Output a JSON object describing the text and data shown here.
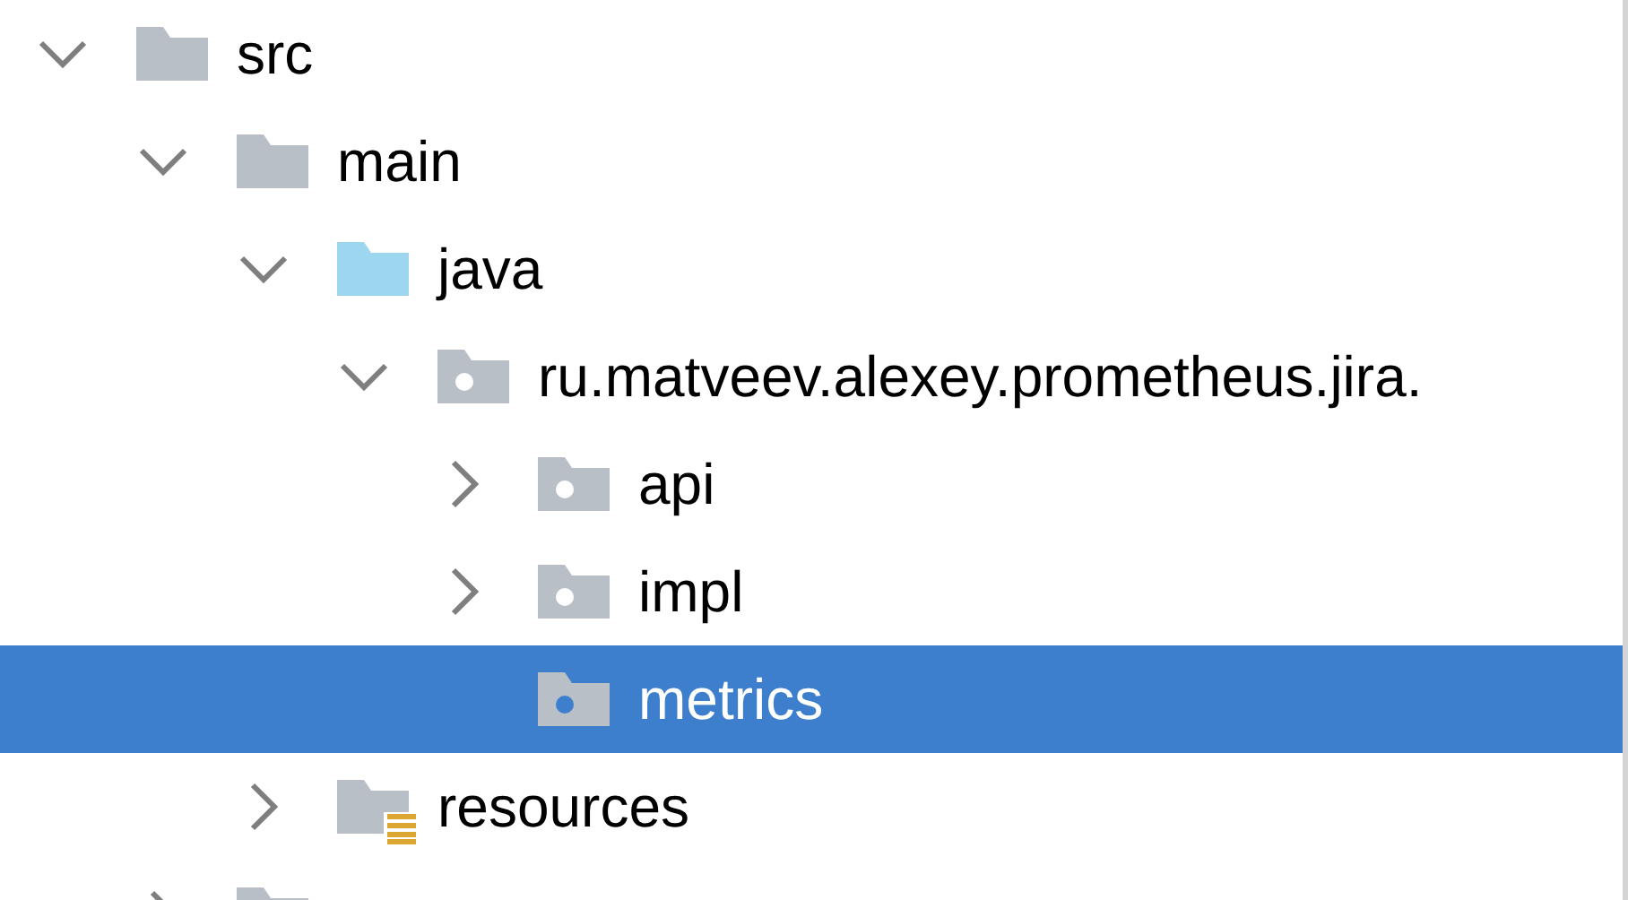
{
  "tree": [
    {
      "label": "src",
      "kind": "folder",
      "expanded": true,
      "selected": false,
      "children": [
        {
          "label": "main",
          "kind": "folder",
          "expanded": true,
          "selected": false,
          "children": [
            {
              "label": "java",
              "kind": "source-root",
              "expanded": true,
              "selected": false,
              "children": [
                {
                  "label": "ru.matveev.alexey.prometheus.jira.",
                  "kind": "package",
                  "expanded": true,
                  "selected": false,
                  "children": [
                    {
                      "label": "api",
                      "kind": "package",
                      "expanded": false,
                      "selected": false
                    },
                    {
                      "label": "impl",
                      "kind": "package",
                      "expanded": false,
                      "selected": false
                    },
                    {
                      "label": "metrics",
                      "kind": "package",
                      "selected": true
                    }
                  ]
                }
              ]
            },
            {
              "label": "resources",
              "kind": "resources",
              "expanded": false,
              "selected": false
            }
          ]
        },
        {
          "kind": "folder",
          "expanded": false,
          "selected": false
        }
      ]
    }
  ]
}
